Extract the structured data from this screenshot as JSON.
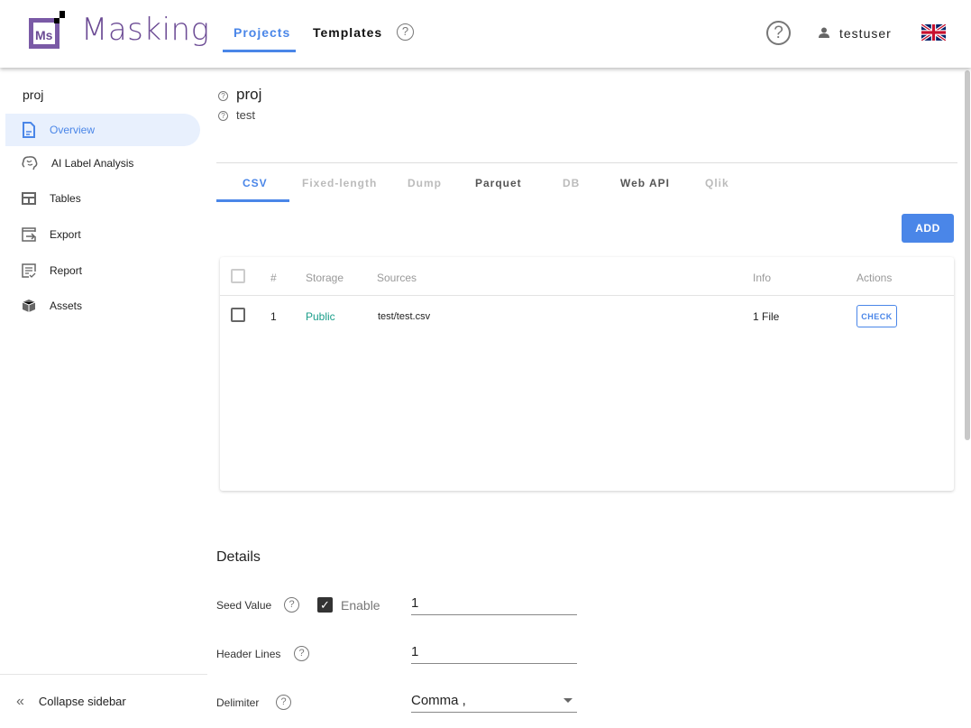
{
  "header": {
    "logo_text": "Masking",
    "logo_mark": "Ms",
    "nav": [
      {
        "label": "Projects",
        "active": true
      },
      {
        "label": "Templates",
        "active": false
      }
    ],
    "help_icon": "help-circle-icon",
    "user": "testuser",
    "language_icon": "uk-flag-icon"
  },
  "colors": {
    "accent": "#4a86e8",
    "public": "#1a9e8a",
    "brand": "#6b4a94"
  },
  "sidebar": {
    "project": "proj",
    "items": [
      {
        "label": "Overview",
        "icon": "document-icon",
        "active": true
      },
      {
        "label": "AI Label Analysis",
        "icon": "brain-icon"
      },
      {
        "label": "Tables",
        "icon": "table-icon"
      },
      {
        "label": "Export",
        "icon": "export-icon"
      },
      {
        "label": "Report",
        "icon": "report-icon"
      },
      {
        "label": "Assets",
        "icon": "box-icon"
      }
    ],
    "collapse": "Collapse sidebar"
  },
  "project": {
    "name": "proj",
    "description": "test"
  },
  "tabs": [
    {
      "label": "CSV",
      "active": true
    },
    {
      "label": "Fixed-length",
      "disabled": true
    },
    {
      "label": "Dump",
      "disabled": true
    },
    {
      "label": "Parquet"
    },
    {
      "label": "DB",
      "disabled": true
    },
    {
      "label": "Web API"
    },
    {
      "label": "Qlik",
      "disabled": true
    }
  ],
  "add_label": "ADD",
  "table": {
    "headers": [
      "#",
      "Storage",
      "Sources",
      "Info",
      "Actions"
    ],
    "rows": [
      {
        "num": "1",
        "storage": "Public",
        "sources": "test/test.csv",
        "info": "1 File",
        "action": "CHECK"
      }
    ]
  },
  "details": {
    "title": "Details",
    "seed_label": "Seed Value",
    "seed_enable": "Enable",
    "seed_enabled": true,
    "seed_value": "1",
    "header_label": "Header Lines",
    "header_value": "1",
    "delimiter_label": "Delimiter",
    "delimiter_value": "Comma ,"
  }
}
